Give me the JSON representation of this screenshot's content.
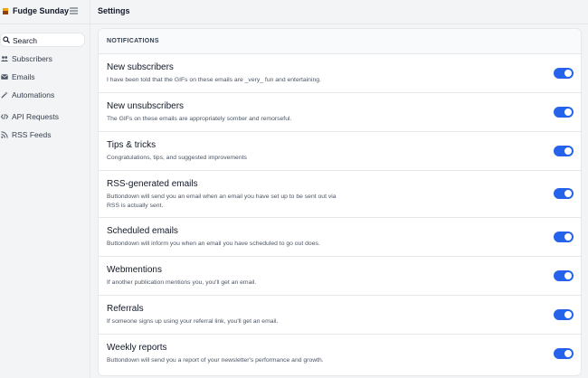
{
  "brand": {
    "name": "Fudge Sunday"
  },
  "header": {
    "title": "Settings"
  },
  "sidebar": {
    "search_label": "Search",
    "items": [
      {
        "label": "Subscribers",
        "icon": "users-icon"
      },
      {
        "label": "Emails",
        "icon": "envelope-icon"
      },
      {
        "label": "Automations",
        "icon": "wand-icon"
      },
      {
        "label": "API Requests",
        "icon": "code-icon"
      },
      {
        "label": "RSS Feeds",
        "icon": "rss-icon"
      }
    ]
  },
  "notifications": {
    "heading": "NOTIFICATIONS",
    "items": [
      {
        "title": "New subscribers",
        "description": "I have been told that the GIFs on these emails are _very_ fun and entertaining.",
        "enabled": true
      },
      {
        "title": "New unsubscribers",
        "description": "The GIFs on these emails are appropriately somber and remorseful.",
        "enabled": true
      },
      {
        "title": "Tips & tricks",
        "description": "Congratulations, tips, and suggested improvements",
        "enabled": true
      },
      {
        "title": "RSS-generated emails",
        "description": "Buttondown will send you an email when an email you have set up to be sent out via RSS is actually sent.",
        "enabled": true
      },
      {
        "title": "Scheduled emails",
        "description": "Buttondown will inform you when an email you have scheduled to go out does.",
        "enabled": true
      },
      {
        "title": "Webmentions",
        "description": "If another publication mentions you, you'll get an email.",
        "enabled": true
      },
      {
        "title": "Referrals",
        "description": "If someone signs up using your referral link, you'll get an email.",
        "enabled": true
      },
      {
        "title": "Weekly reports",
        "description": "Buttondown will send you a report of your newsletter's performance and growth.",
        "enabled": true
      }
    ]
  },
  "colors": {
    "accent": "#2563eb",
    "background": "#f3f4f6",
    "panel": "#ffffff"
  }
}
